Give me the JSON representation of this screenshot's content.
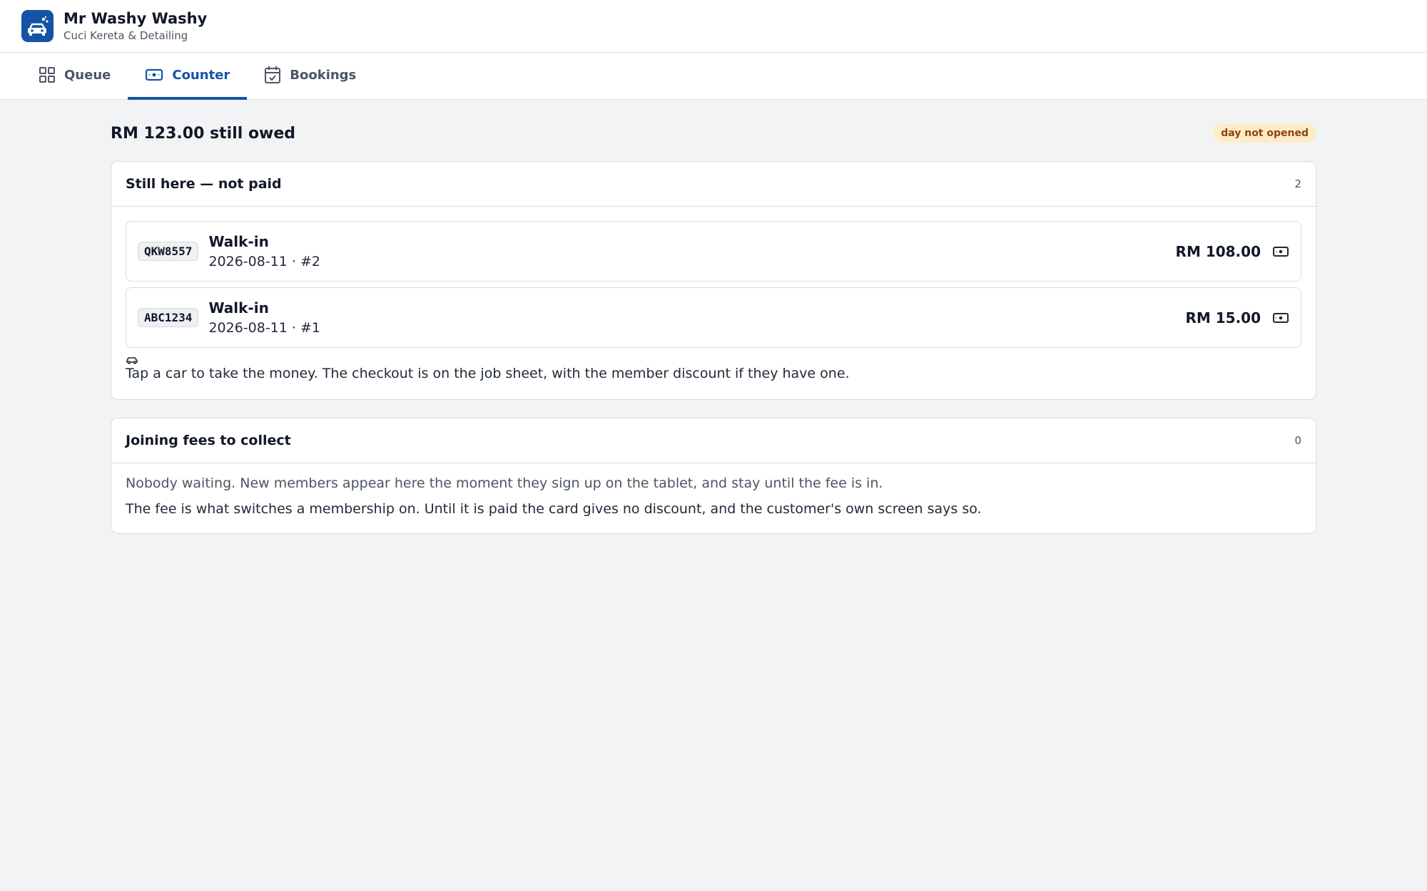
{
  "app": {
    "title": "Mr Washy Washy",
    "subtitle": "Cuci Kereta & Detailing",
    "logo_icon": "car-wash-icon",
    "accent_color": "#1454a6"
  },
  "tabs": [
    {
      "label": "Queue",
      "icon": "grid-icon",
      "active": false
    },
    {
      "label": "Counter",
      "icon": "cash-icon",
      "active": true
    },
    {
      "label": "Bookings",
      "icon": "calendar-check-icon",
      "active": false
    }
  ],
  "summary": {
    "owed_text": "RM 123.00 still owed",
    "status_badge": "day not opened"
  },
  "unpaid": {
    "title": "Still here — not paid",
    "count": "2",
    "jobs": [
      {
        "plate": "QKW8557",
        "type": "Walk-in",
        "meta": "2026-08-11 · #2",
        "amount": "RM 108.00"
      },
      {
        "plate": "ABC1234",
        "type": "Walk-in",
        "meta": "2026-08-11 · #1",
        "amount": "RM 15.00"
      }
    ],
    "hint": "Tap a car to take the money. The checkout is on the job sheet, with the member discount if they have one."
  },
  "fees": {
    "title": "Joining fees to collect",
    "count": "0",
    "empty_text": "Nobody waiting. New members appear here the moment they sign up on the tablet, and stay until the fee is in.",
    "note": "The fee is what switches a membership on. Until it is paid the card gives no discount, and the customer's own screen says so."
  }
}
